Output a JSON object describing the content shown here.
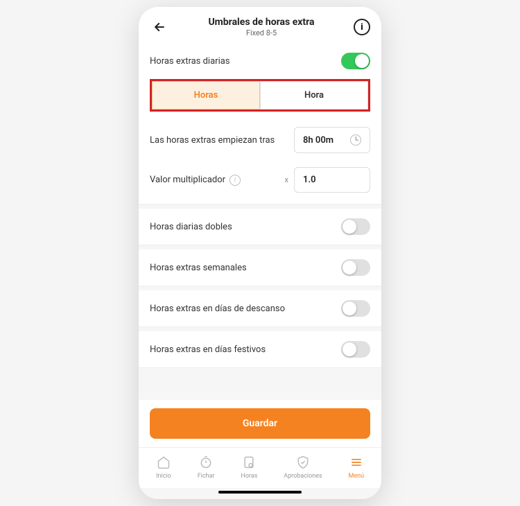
{
  "header": {
    "title": "Umbrales de horas extra",
    "subtitle": "Fixed 8-5"
  },
  "daily": {
    "label": "Horas extras diarias",
    "tabs": {
      "hours": "Horas",
      "hour": "Hora"
    },
    "start_after_label": "Las horas extras empiezan tras",
    "start_after_value": "8h 00m",
    "multiplier_label": "Valor multiplicador",
    "multiplier_x": "x",
    "multiplier_value": "1.0"
  },
  "toggles": {
    "double_daily": "Horas diarias dobles",
    "weekly": "Horas extras semanales",
    "restday": "Horas extras en días de descanso",
    "holiday": "Horas extras en días festivos"
  },
  "save_label": "Guardar",
  "nav": {
    "home": "Inicio",
    "clockin": "Fichar",
    "hours": "Horas",
    "approvals": "Aprobaciones",
    "menu": "Menú"
  }
}
